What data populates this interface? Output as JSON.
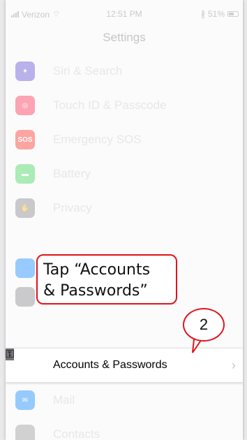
{
  "status_bar": {
    "carrier": "Verizon",
    "time": "12:51 PM",
    "battery": "51%"
  },
  "nav": {
    "title": "Settings"
  },
  "rows": [
    {
      "label": "Siri & Search",
      "icon": "siri-icon",
      "color": "#6b5bd6"
    },
    {
      "label": "Touch ID & Passcode",
      "icon": "fingerprint-icon",
      "color": "#ff3b5c"
    },
    {
      "label": "Emergency SOS",
      "icon": "sos-icon",
      "icon_text": "SOS",
      "color": "#ff3b30"
    },
    {
      "label": "Battery",
      "icon": "battery-icon",
      "color": "#4cd964"
    },
    {
      "label": "Privacy",
      "icon": "hand-icon",
      "color": "#8e8e93"
    }
  ],
  "highlight": {
    "label": "Accounts & Passwords",
    "icon": "key-icon"
  },
  "below_rows": [
    {
      "label": "Mail",
      "icon": "mail-icon",
      "color": "#1e90ff"
    },
    {
      "label": "Contacts",
      "icon": "contacts-icon",
      "color": "#a0a0a0"
    }
  ],
  "annotation": {
    "callout_line1": "Tap “Accounts",
    "callout_line2": "& Passwords”",
    "step": "2"
  },
  "colors": {
    "accent_red": "#e0141b"
  }
}
